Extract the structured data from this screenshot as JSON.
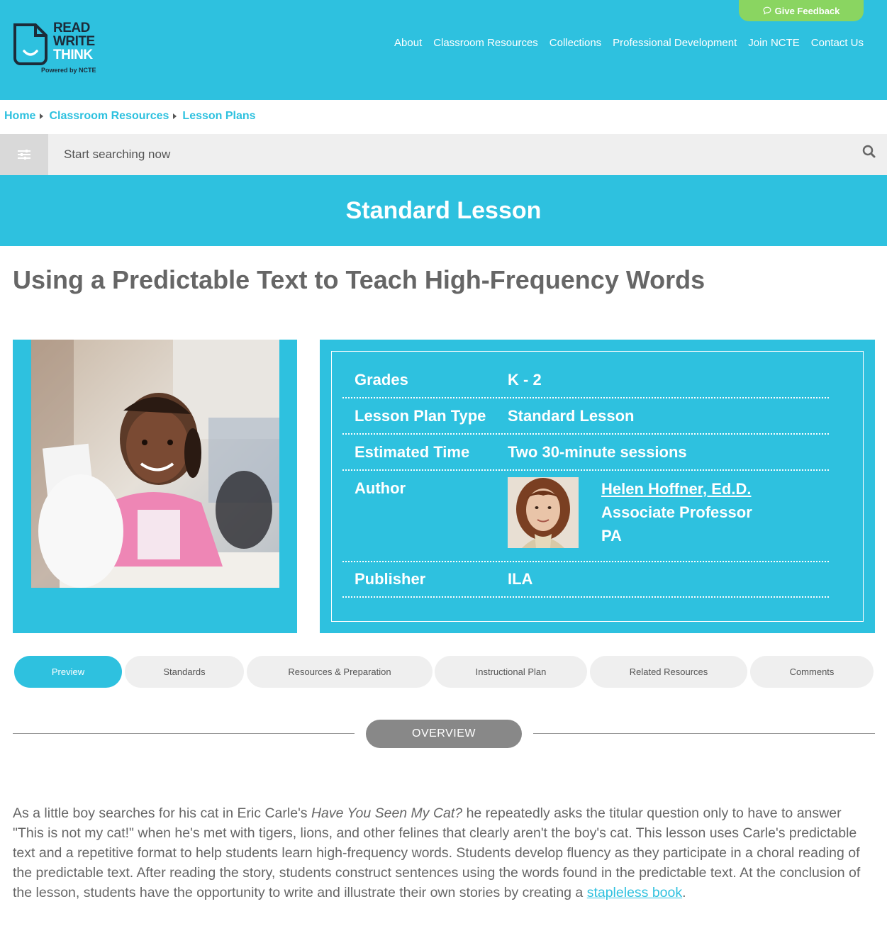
{
  "header": {
    "feedback_label": "Give Feedback",
    "logo": {
      "line1": "READ",
      "line2": "WRITE",
      "line3": "THINK",
      "sub": "Powered by NCTE"
    },
    "nav": [
      "About",
      "Classroom Resources",
      "Collections",
      "Professional Development",
      "Join NCTE",
      "Contact Us"
    ]
  },
  "breadcrumb": [
    "Home",
    "Classroom Resources",
    "Lesson Plans"
  ],
  "search": {
    "placeholder": "Start searching now"
  },
  "banner": {
    "title": "Standard Lesson"
  },
  "page_title": "Using a Predictable Text to Teach High-Frequency Words",
  "info": {
    "grades_label": "Grades",
    "grades_value": "K - 2",
    "type_label": "Lesson Plan Type",
    "type_value": "Standard Lesson",
    "time_label": "Estimated Time",
    "time_value": "Two 30-minute sessions",
    "author_label": "Author",
    "author_name": "Helen Hoffner, Ed.D.",
    "author_title": "Associate Professor",
    "author_state": "PA",
    "publisher_label": "Publisher",
    "publisher_value": "ILA"
  },
  "tabs": [
    "Preview",
    "Standards",
    "Resources & Preparation",
    "Instructional Plan",
    "Related Resources",
    "Comments"
  ],
  "active_tab": "Preview",
  "overview_label": "OVERVIEW",
  "description": {
    "part1": "As a little boy searches for his cat in Eric Carle's ",
    "book_title": "Have You Seen My Cat?",
    "part2": " he repeatedly asks the titular question only to have to answer \"This is not my cat!\" when he's met with tigers, lions, and other felines that clearly aren't the boy's cat. This lesson uses Carle's predictable text and a repetitive format to help students learn high-frequency words. Students develop fluency as they participate in a choral reading of the predictable text. After reading the story, students construct sentences using the words found in the predictable text. At the conclusion of the lesson, students have the opportunity to write and illustrate their own stories by creating a ",
    "link": "stapleless book",
    "part3": "."
  },
  "colors": {
    "brand": "#2ec1df",
    "feedback": "#8ad561",
    "logo_dark": "#1c2b39",
    "overview_pill": "#888888"
  }
}
